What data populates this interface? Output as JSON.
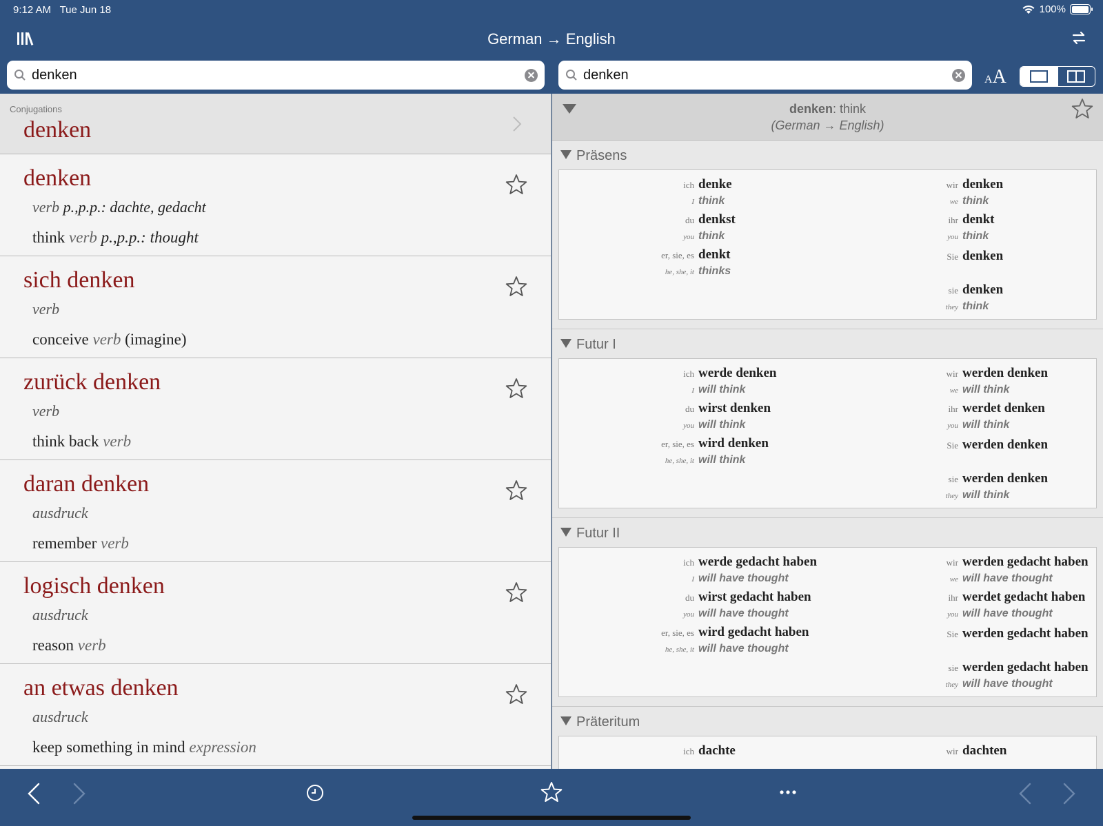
{
  "status": {
    "time": "9:12 AM",
    "date": "Tue Jun 18",
    "battery": "100%",
    "battery_level": 1.0
  },
  "nav": {
    "title": "German → English"
  },
  "search_left": {
    "value": "denken",
    "placeholder": ""
  },
  "search_right": {
    "value": "denken",
    "placeholder": ""
  },
  "text_size": {
    "small": "A",
    "big": "A"
  },
  "left": {
    "conjugations_label": "Conjugations",
    "conjugations_word": "denken",
    "entries": [
      {
        "headword": "denken",
        "pos": "verb",
        "pos_extra": "p.,p.p.: dachte, gedacht",
        "translation": "think",
        "tr_pos": "verb",
        "tr_extra": "p.,p.p.: thought",
        "tr_note": ""
      },
      {
        "headword": "sich denken",
        "pos": "verb",
        "pos_extra": "",
        "translation": "conceive",
        "tr_pos": "verb",
        "tr_extra": "",
        "tr_note": "(imagine)"
      },
      {
        "headword": "zurück denken",
        "pos": "verb",
        "pos_extra": "",
        "translation": "think back",
        "tr_pos": "verb",
        "tr_extra": "",
        "tr_note": ""
      },
      {
        "headword": "daran denken",
        "pos": "ausdruck",
        "pos_extra": "",
        "translation": "remember",
        "tr_pos": "verb",
        "tr_extra": "",
        "tr_note": ""
      },
      {
        "headword": "logisch denken",
        "pos": "ausdruck",
        "pos_extra": "",
        "translation": "reason",
        "tr_pos": "verb",
        "tr_extra": "",
        "tr_note": ""
      },
      {
        "headword": "an etwas denken",
        "pos": "ausdruck",
        "pos_extra": "",
        "translation": "keep something in mind",
        "tr_pos": "expression",
        "tr_extra": "",
        "tr_note": ""
      }
    ]
  },
  "right": {
    "header_word": "denken",
    "header_sep": ":",
    "header_trans": "think",
    "header_dir": "(German → English)",
    "sections": [
      {
        "title": "Präsens",
        "left": [
          {
            "p": "ich",
            "v": "denke",
            "pe": "I",
            "t": "think"
          },
          {
            "p": "du",
            "v": "denkst",
            "pe": "you",
            "t": "think"
          },
          {
            "p": "er, sie, es",
            "v": "denkt",
            "pe": "he, she, it",
            "t": "thinks"
          }
        ],
        "right": [
          {
            "p": "wir",
            "v": "denken",
            "pe": "we",
            "t": "think"
          },
          {
            "p": "ihr",
            "v": "denkt",
            "pe": "you",
            "t": "think"
          },
          {
            "p": "Sie",
            "v": "denken",
            "pe": "",
            "t": ""
          },
          {
            "p": "sie",
            "v": "denken",
            "pe": "they",
            "t": "think"
          }
        ]
      },
      {
        "title": "Futur I",
        "left": [
          {
            "p": "ich",
            "v": "werde denken",
            "pe": "I",
            "t": "will think"
          },
          {
            "p": "du",
            "v": "wirst denken",
            "pe": "you",
            "t": "will think"
          },
          {
            "p": "er, sie, es",
            "v": "wird denken",
            "pe": "he, she, it",
            "t": "will think"
          }
        ],
        "right": [
          {
            "p": "wir",
            "v": "werden denken",
            "pe": "we",
            "t": "will think"
          },
          {
            "p": "ihr",
            "v": "werdet denken",
            "pe": "you",
            "t": "will think"
          },
          {
            "p": "Sie",
            "v": "werden denken",
            "pe": "",
            "t": ""
          },
          {
            "p": "sie",
            "v": "werden denken",
            "pe": "they",
            "t": "will think"
          }
        ]
      },
      {
        "title": "Futur II",
        "left": [
          {
            "p": "ich",
            "v": "werde gedacht haben",
            "pe": "I",
            "t": "will have thought"
          },
          {
            "p": "du",
            "v": "wirst gedacht haben",
            "pe": "you",
            "t": "will have thought"
          },
          {
            "p": "er, sie, es",
            "v": "wird gedacht haben",
            "pe": "he, she, it",
            "t": "will have thought"
          }
        ],
        "right": [
          {
            "p": "wir",
            "v": "werden gedacht haben",
            "pe": "we",
            "t": "will have thought"
          },
          {
            "p": "ihr",
            "v": "werdet gedacht haben",
            "pe": "you",
            "t": "will have thought"
          },
          {
            "p": "Sie",
            "v": "werden gedacht haben",
            "pe": "",
            "t": ""
          },
          {
            "p": "sie",
            "v": "werden gedacht haben",
            "pe": "they",
            "t": "will have thought"
          }
        ]
      },
      {
        "title": "Präteritum",
        "left": [
          {
            "p": "ich",
            "v": "dachte",
            "pe": "",
            "t": ""
          }
        ],
        "right": [
          {
            "p": "wir",
            "v": "dachten",
            "pe": "",
            "t": ""
          }
        ]
      }
    ]
  },
  "colors": {
    "bar": "#2f5280",
    "headword": "#8b1a1a"
  }
}
